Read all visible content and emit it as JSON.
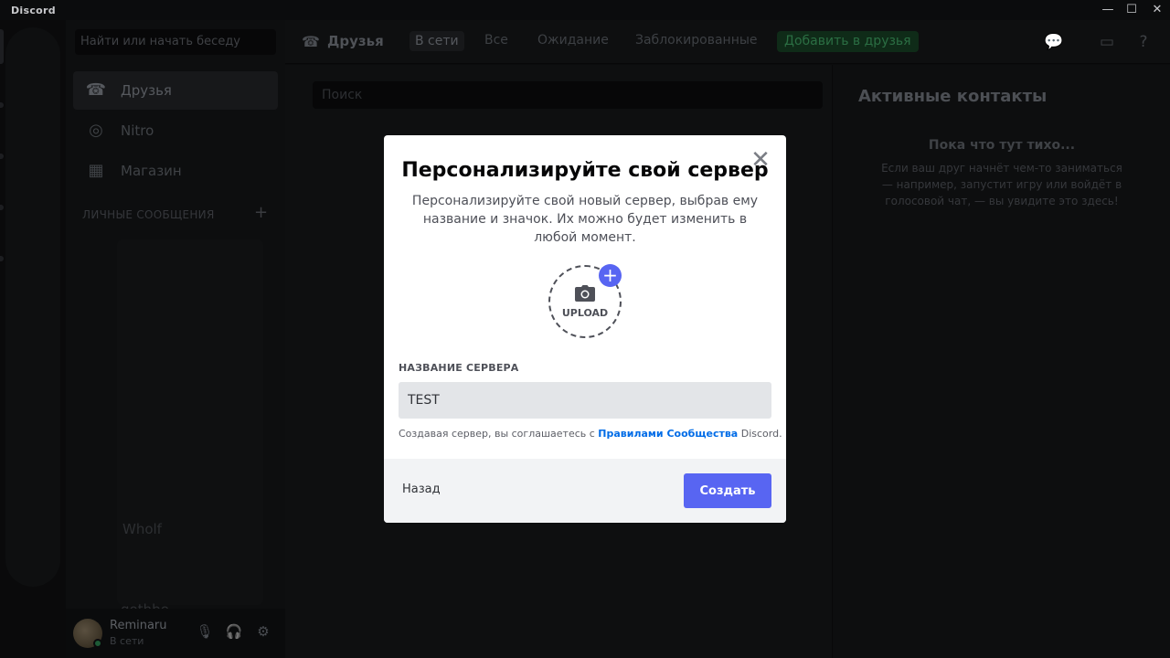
{
  "window": {
    "title": "Discord",
    "controls": [
      "—",
      "☐",
      "✕"
    ]
  },
  "dm_sidebar": {
    "search_placeholder": "Найти или начать беседу",
    "nav": [
      {
        "label": "Друзья",
        "icon": "friends-icon"
      },
      {
        "label": "Nitro",
        "icon": "nitro-icon"
      },
      {
        "label": "Магазин",
        "icon": "shop-icon"
      }
    ],
    "section_header": "ЛИЧНЫЕ СООБЩЕНИЯ",
    "visible_names": [
      "Wholf",
      "gothbe"
    ]
  },
  "user_panel": {
    "username": "Reminaru",
    "status": "В сети"
  },
  "topbar": {
    "title": "Друзья",
    "tabs": [
      "В сети",
      "Все",
      "Ожидание",
      "Заблокированные"
    ],
    "add_friend": "Добавить в друзья"
  },
  "main": {
    "search_placeholder": "Поиск"
  },
  "right": {
    "title": "Активные контакты",
    "empty_title": "Пока что тут тихо...",
    "empty_desc": "Если ваш друг начнёт чем-то заниматься — например, запустит игру или войдёт в голосовой чат, — вы увидите это здесь!"
  },
  "modal": {
    "title": "Персонализируйте свой сервер",
    "subtitle": "Персонализируйте свой новый сервер, выбрав ему название и значок. Их можно будет изменить в любой момент.",
    "upload_label": "UPLOAD",
    "field_label": "НАЗВАНИЕ СЕРВЕРА",
    "field_value": "TEST",
    "terms_prefix": "Создавая сервер, вы соглашаетесь с ",
    "terms_link": "Правилами Сообщества",
    "terms_suffix": " Discord.",
    "back_label": "Назад",
    "create_label": "Создать"
  },
  "colors": {
    "accent": "#5865f2",
    "link": "#006ce7"
  }
}
